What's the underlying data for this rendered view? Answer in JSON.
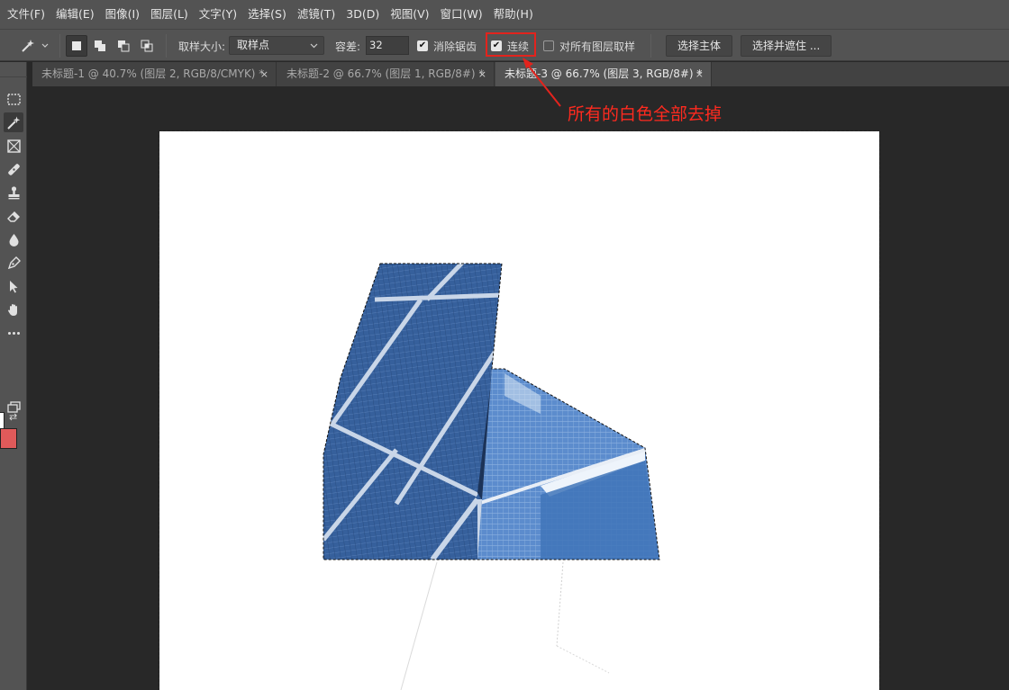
{
  "menu": {
    "items": [
      "文件(F)",
      "编辑(E)",
      "图像(I)",
      "图层(L)",
      "文字(Y)",
      "选择(S)",
      "滤镜(T)",
      "3D(D)",
      "视图(V)",
      "窗口(W)",
      "帮助(H)"
    ]
  },
  "options": {
    "sample_size_label": "取样大小:",
    "sample_size_value": "取样点",
    "tolerance_label": "容差:",
    "tolerance_value": "32",
    "antialias_label": "消除锯齿",
    "antialias_checked": true,
    "contiguous_label": "连续",
    "contiguous_checked": true,
    "sample_all_label": "对所有图层取样",
    "sample_all_checked": false,
    "select_subject_label": "选择主体",
    "select_mask_label": "选择并遮住 ..."
  },
  "tabs": [
    {
      "label": "未标题-1 @ 40.7% (图层 2, RGB/8/CMYK) *",
      "active": false
    },
    {
      "label": "未标题-2 @ 66.7% (图层 1, RGB/8#) *",
      "active": false
    },
    {
      "label": "未标题-3 @ 66.7% (图层 3, RGB/8#) *",
      "active": true
    }
  ],
  "tab_close_glyph": "×",
  "annotation": {
    "text": "所有的白色全部去掉",
    "color": "#ff2a1f"
  },
  "toolbar": {
    "tools": [
      "marquee-icon",
      "magic-wand-icon",
      "frame-icon",
      "healing-brush-icon",
      "stamp-icon",
      "eraser-icon",
      "blur-drop-icon",
      "pen-icon",
      "path-select-icon",
      "hand-icon",
      "more-tools-icon"
    ],
    "active_tool": "magic-wand-icon",
    "foreground_color": "#ffffff",
    "background_color": "#e05a5a"
  },
  "colors": {
    "menu_bg": "#535353",
    "workspace_bg": "#282828",
    "highlight_red": "#e3231d",
    "glass_blue": "#3f6aa6"
  }
}
